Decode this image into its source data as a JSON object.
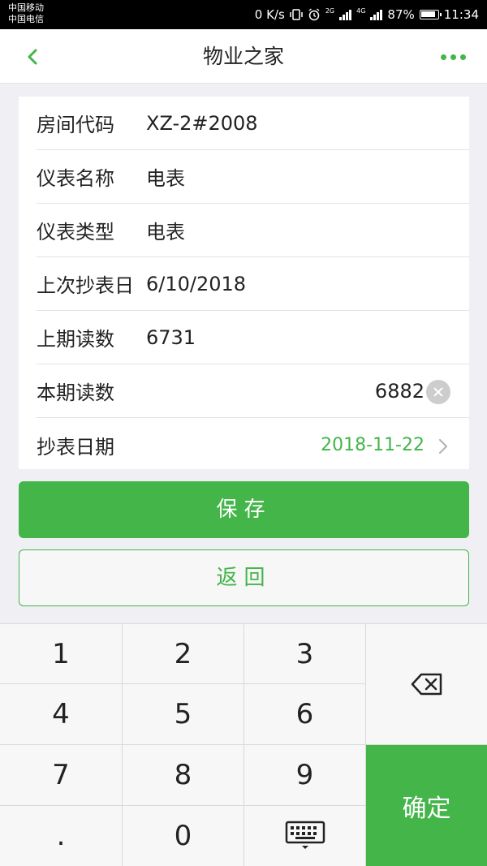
{
  "status_bar": {
    "carrier_1": "中国移动",
    "carrier_2": "中国电信",
    "net_speed": "0 K/s",
    "net_2g": "2G",
    "net_4g": "4G",
    "battery": "87%",
    "time": "11:34"
  },
  "nav": {
    "title": "物业之家",
    "back_icon": "chevron-left",
    "more_icon": "more-horizontal"
  },
  "form": {
    "rows": [
      {
        "label": "房间代码",
        "value": "XZ-2#2008"
      },
      {
        "label": "仪表名称",
        "value": "电表"
      },
      {
        "label": "仪表类型",
        "value": "电表"
      },
      {
        "label": "上次抄表日",
        "value": "6/10/2018"
      },
      {
        "label": "上期读数",
        "value": "6731"
      },
      {
        "label": "本期读数",
        "value": "6882"
      },
      {
        "label": "抄表日期",
        "value": "2018-11-22"
      }
    ]
  },
  "buttons": {
    "save": "保存",
    "back": "返回"
  },
  "keypad": {
    "keys": [
      "1",
      "2",
      "3",
      "4",
      "5",
      "6",
      "7",
      "8",
      "9",
      ".",
      "0"
    ],
    "confirm": "确定",
    "backspace_icon": "backspace",
    "hide_icon": "keyboard-hide"
  },
  "colors": {
    "accent": "#43b549",
    "status_bar": "#000000",
    "background": "#efeff4"
  }
}
